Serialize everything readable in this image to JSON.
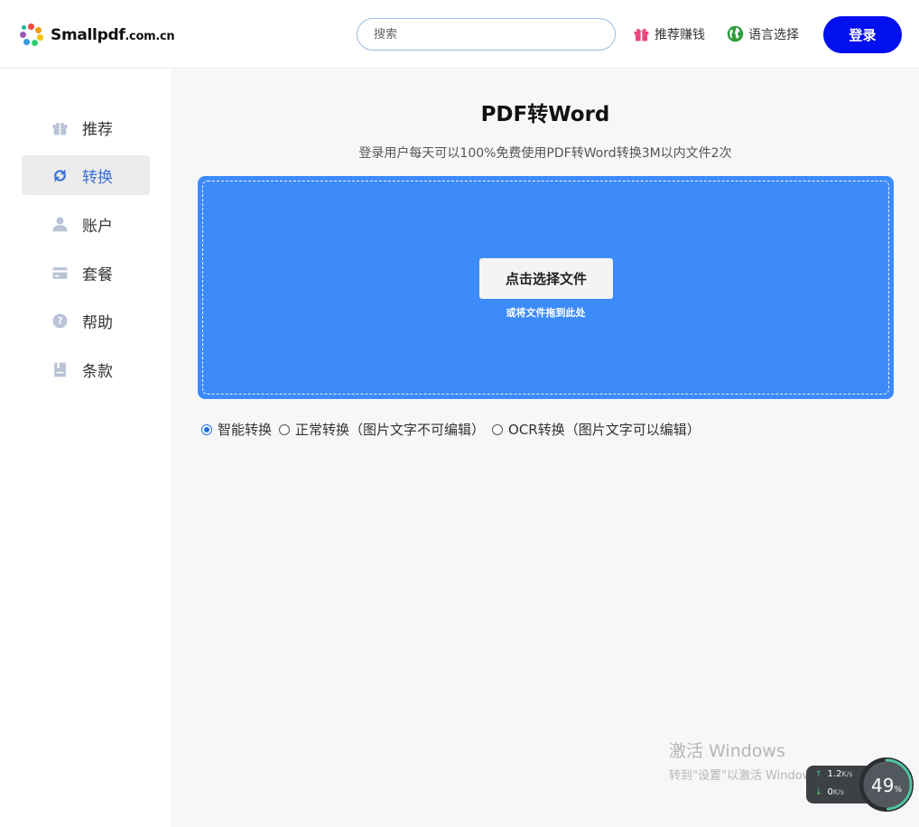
{
  "header": {
    "logo_text": "Smallpdf",
    "logo_domain": ".com.cn",
    "search_placeholder": "搜索",
    "refer_label": "推荐赚钱",
    "language_label": "语言选择",
    "login_label": "登录"
  },
  "sidebar": {
    "items": [
      {
        "label": "推荐",
        "icon": "gift-icon",
        "active": false
      },
      {
        "label": "转换",
        "icon": "sync-icon",
        "active": true
      },
      {
        "label": "账户",
        "icon": "user-icon",
        "active": false
      },
      {
        "label": "套餐",
        "icon": "card-icon",
        "active": false
      },
      {
        "label": "帮助",
        "icon": "help-icon",
        "active": false
      },
      {
        "label": "条款",
        "icon": "document-icon",
        "active": false
      }
    ]
  },
  "main": {
    "title": "PDF转Word",
    "subtitle": "登录用户每天可以100%免费使用PDF转Word转换3M以内文件2次",
    "choose_button": "点击选择文件",
    "drop_hint": "或将文件拖到此处",
    "options": [
      {
        "label": "智能转换",
        "checked": true
      },
      {
        "label": "正常转换（图片文字不可编辑）",
        "checked": false
      },
      {
        "label": "OCR转换（图片文字可以编辑）",
        "checked": false
      }
    ]
  },
  "watermark": {
    "line1": "激活 Windows",
    "line2": "转到\"设置\"以激活 Windows。"
  },
  "speed_widget": {
    "up_value": "1.2",
    "up_unit": "K/s",
    "down_value": "0",
    "down_unit": "K/s",
    "percent": "49",
    "percent_unit": "%"
  },
  "colors": {
    "accent": "#0010ef",
    "dropzone": "#3d8bfa",
    "active_nav_text": "#3a6fd8",
    "refer_icon": "#e8467c",
    "globe_icon": "#2e9e3e",
    "nav_icon": "#b9c3d6"
  }
}
